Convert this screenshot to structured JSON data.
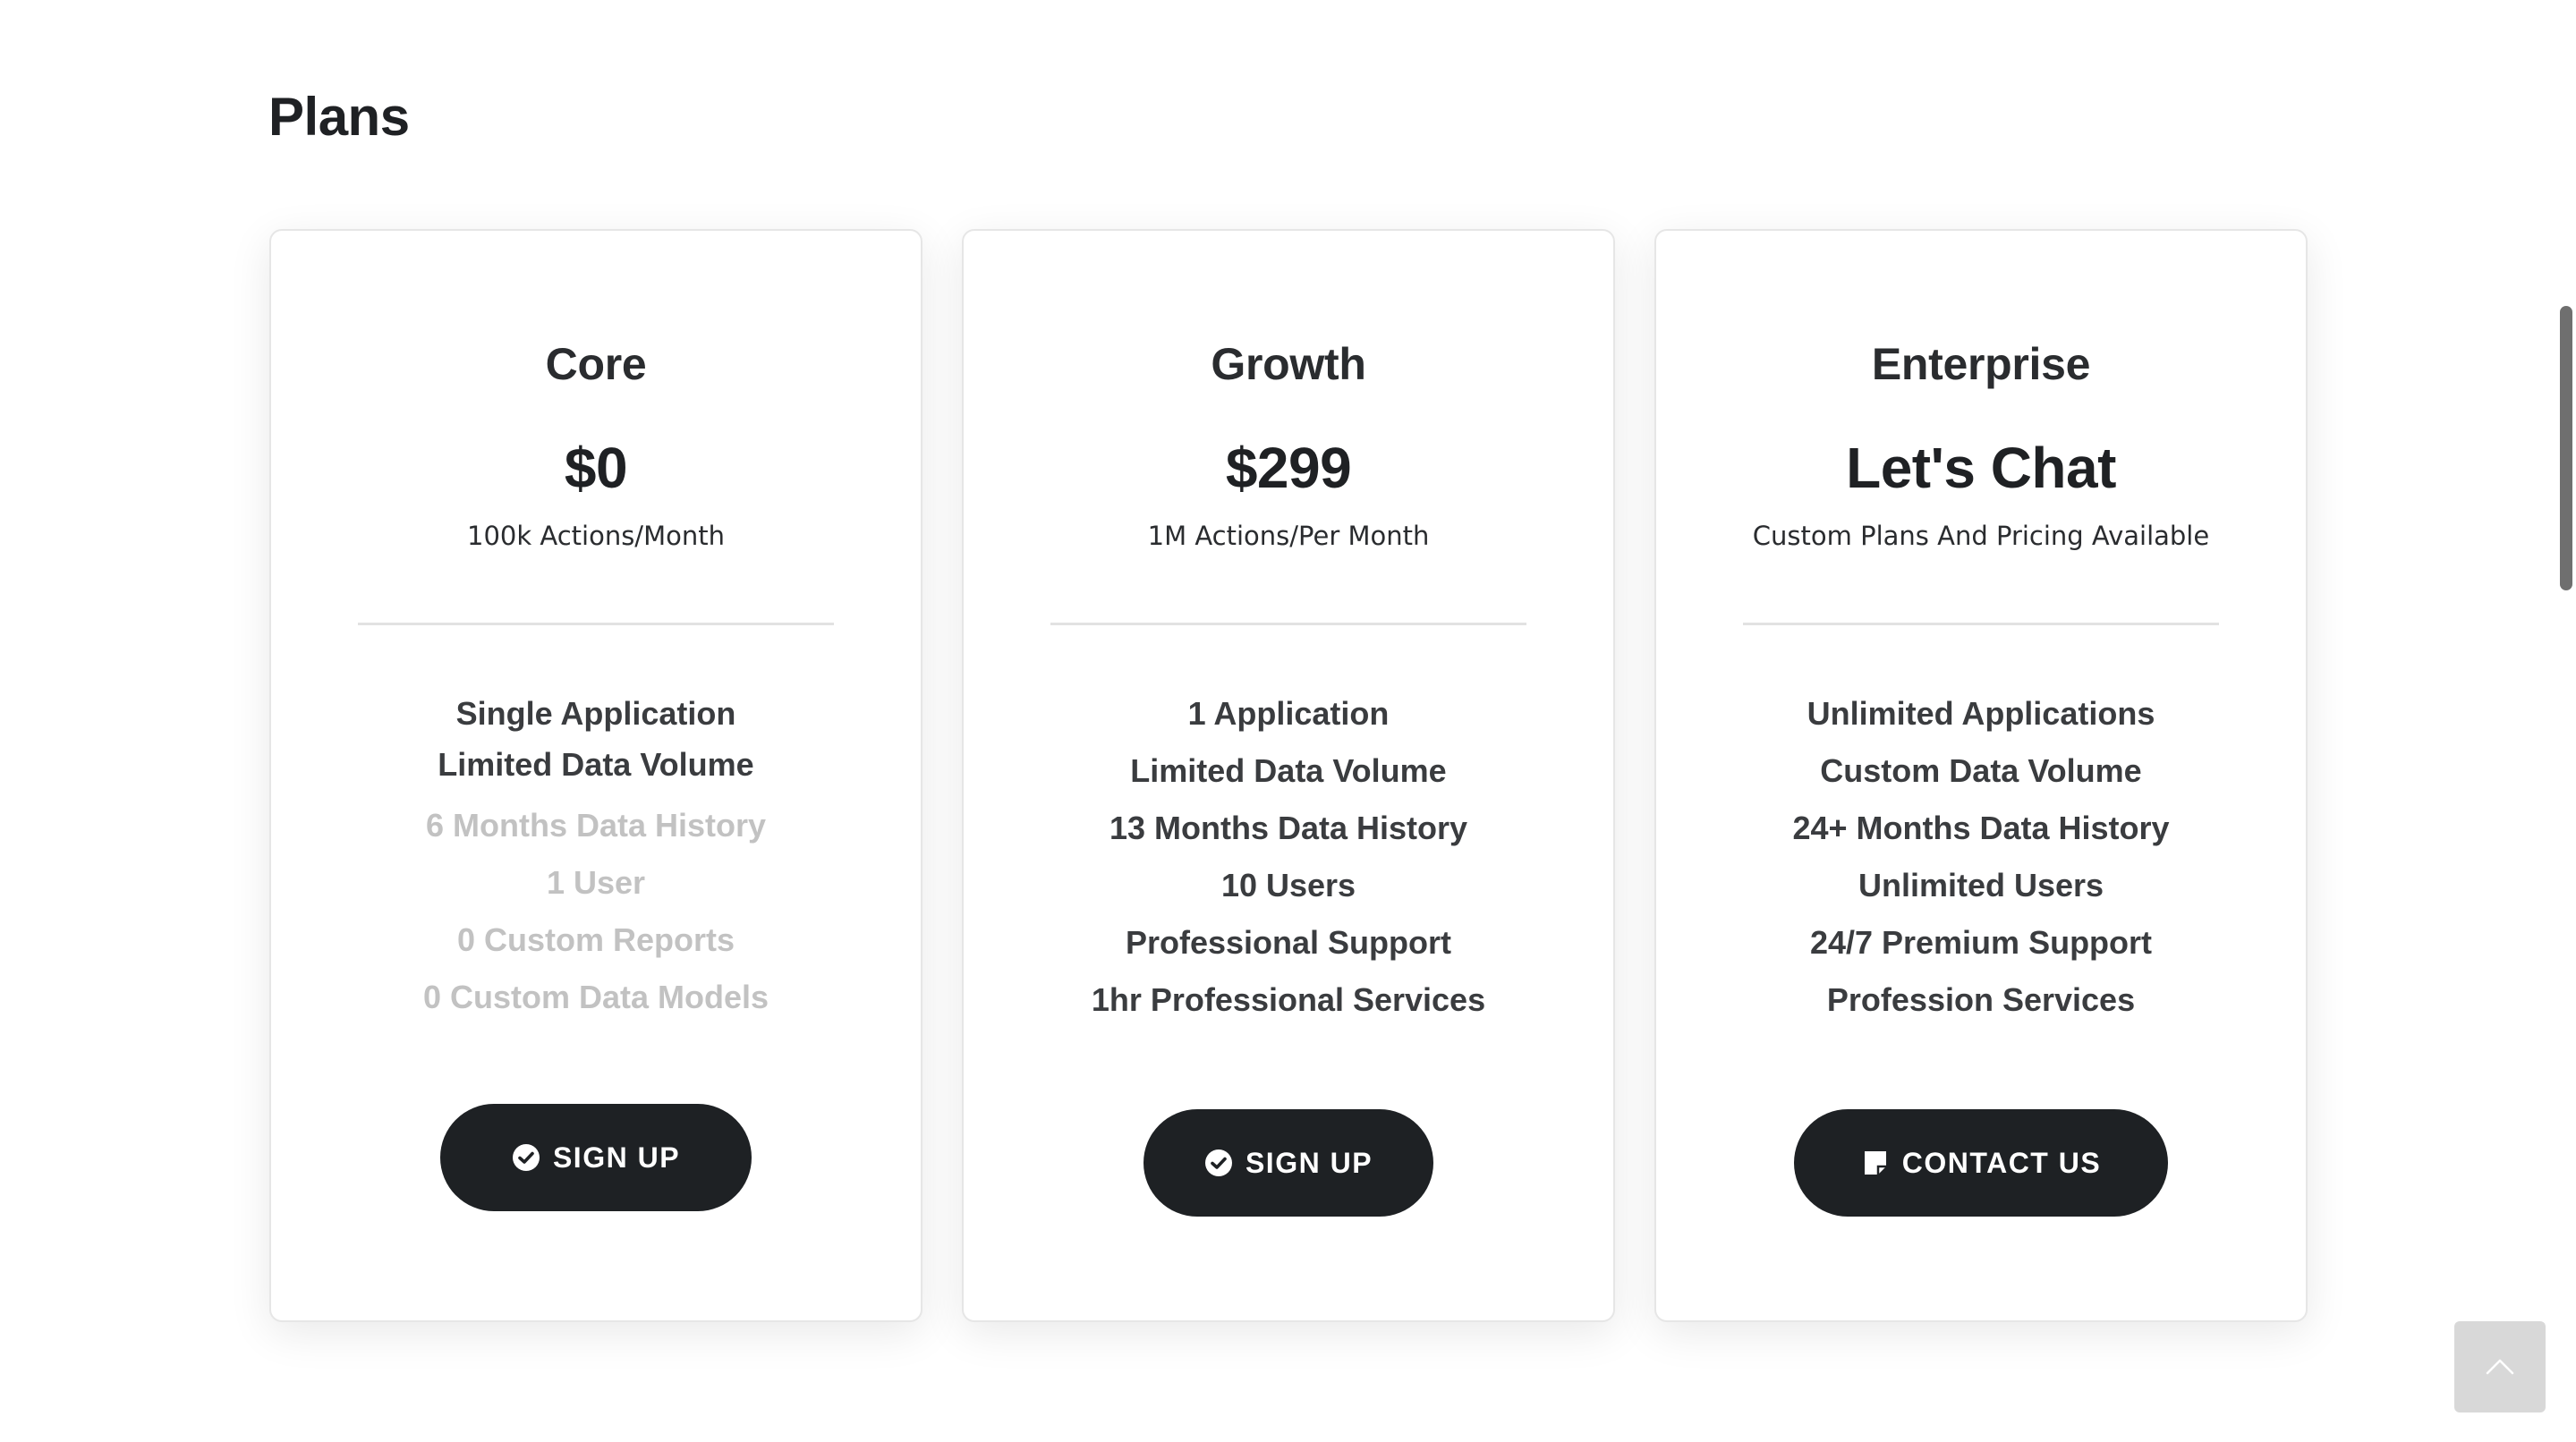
{
  "section": {
    "title": "Plans"
  },
  "plans": [
    {
      "name": "Core",
      "price": "$0",
      "subtitle": "100k Actions/Month",
      "features": [
        {
          "text": "Single Application",
          "included": true
        },
        {
          "text": "Limited Data Volume",
          "included": true
        },
        {
          "text": "6 Months Data History",
          "included": false
        },
        {
          "text": "1 User",
          "included": false
        },
        {
          "text": "0 Custom Reports",
          "included": false
        },
        {
          "text": "0 Custom Data Models",
          "included": false
        }
      ],
      "button": {
        "label": "SIGN UP",
        "icon": "check-circle-icon"
      }
    },
    {
      "name": "Growth",
      "price": "$299",
      "subtitle": "1M Actions/Per Month",
      "features": [
        {
          "text": "1 Application",
          "included": true
        },
        {
          "text": "Limited Data Volume",
          "included": true
        },
        {
          "text": "13 Months Data History",
          "included": true
        },
        {
          "text": "10 Users",
          "included": true
        },
        {
          "text": "Professional Support",
          "included": true
        },
        {
          "text": "1hr Professional Services",
          "included": true
        }
      ],
      "button": {
        "label": "SIGN UP",
        "icon": "check-circle-icon"
      }
    },
    {
      "name": "Enterprise",
      "price": "Let's Chat",
      "subtitle": "Custom Plans And Pricing Available",
      "features": [
        {
          "text": "Unlimited Applications",
          "included": true
        },
        {
          "text": "Custom Data Volume",
          "included": true
        },
        {
          "text": "24+ Months Data History",
          "included": true
        },
        {
          "text": "Unlimited Users",
          "included": true
        },
        {
          "text": "24/7 Premium Support",
          "included": true
        },
        {
          "text": "Profession Services",
          "included": true
        }
      ],
      "button": {
        "label": "CONTACT US",
        "icon": "sticky-note-icon"
      }
    }
  ],
  "controls": {
    "back_to_top_icon": "chevron-up-icon"
  },
  "colors": {
    "button_bg": "#1e2124",
    "muted_feature": "#c2c2c2",
    "text_dark": "#222426"
  }
}
